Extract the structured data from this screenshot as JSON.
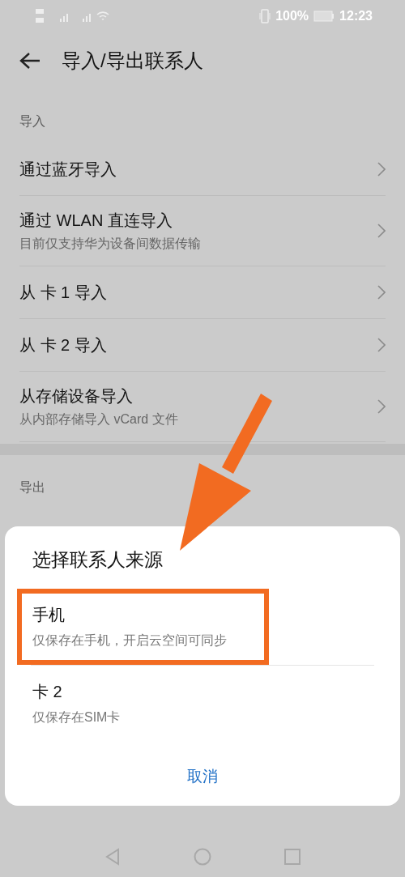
{
  "status_bar": {
    "battery": "100%",
    "time": "12:23"
  },
  "header": {
    "title": "导入/导出联系人"
  },
  "sections": [
    {
      "label": "导入",
      "items": [
        {
          "title": "通过蓝牙导入"
        },
        {
          "title": "通过 WLAN 直连导入",
          "subtitle": "目前仅支持华为设备间数据传输"
        },
        {
          "title": "从 卡 1 导入"
        },
        {
          "title": "从 卡 2 导入"
        },
        {
          "title": "从存储设备导入",
          "subtitle": "从内部存储导入 vCard 文件"
        }
      ]
    },
    {
      "label": "导出"
    }
  ],
  "dialog": {
    "title": "选择联系人来源",
    "options": [
      {
        "title": "手机",
        "subtitle": "仅保存在手机，开启云空间可同步",
        "highlighted": true
      },
      {
        "title": "卡 2",
        "subtitle": "仅保存在SIM卡",
        "highlighted": false
      }
    ],
    "cancel": "取消"
  }
}
